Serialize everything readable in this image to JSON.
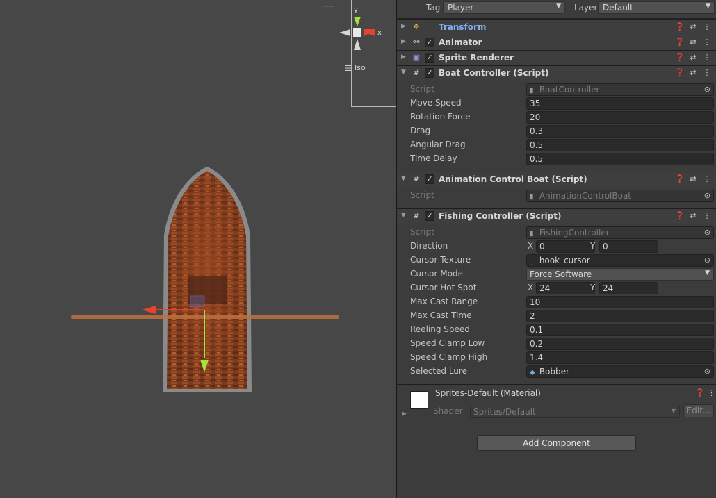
{
  "header": {
    "tag_label": "Tag",
    "tag_value": "Player",
    "layer_label": "Layer",
    "layer_value": "Default"
  },
  "scene": {
    "gizmo_y": "y",
    "gizmo_x": "x",
    "projection": "Iso"
  },
  "components": [
    {
      "title": "Transform",
      "icon": "transform-icon"
    },
    {
      "title": "Animator",
      "icon": "animator-icon"
    },
    {
      "title": "Sprite Renderer",
      "icon": "sprite-renderer-icon"
    },
    {
      "title": "Boat Controller (Script)",
      "icon": "script-icon"
    },
    {
      "title": "Animation Control Boat (Script)",
      "icon": "script-icon"
    },
    {
      "title": "Fishing Controller (Script)",
      "icon": "script-icon"
    }
  ],
  "boat_controller": {
    "script_label": "Script",
    "script_value": "BoatController",
    "fields": [
      {
        "label": "Move Speed",
        "value": "35"
      },
      {
        "label": "Rotation Force",
        "value": "20"
      },
      {
        "label": "Drag",
        "value": "0.3"
      },
      {
        "label": "Angular Drag",
        "value": "0.5"
      },
      {
        "label": "Time Delay",
        "value": "0.5"
      }
    ]
  },
  "animation_control": {
    "script_label": "Script",
    "script_value": "AnimationControlBoat"
  },
  "fishing_controller": {
    "script_label": "Script",
    "script_value": "FishingController",
    "direction_label": "Direction",
    "direction_x": "0",
    "direction_y": "0",
    "cursor_texture_label": "Cursor Texture",
    "cursor_texture_value": "hook_cursor",
    "cursor_mode_label": "Cursor Mode",
    "cursor_mode_value": "Force Software",
    "hot_spot_label": "Cursor Hot Spot",
    "hot_spot_x": "24",
    "hot_spot_y": "24",
    "fields": [
      {
        "label": "Max Cast Range",
        "value": "10"
      },
      {
        "label": "Max Cast Time",
        "value": "2"
      },
      {
        "label": "Reeling Speed",
        "value": "0.1"
      },
      {
        "label": "Speed Clamp Low",
        "value": "0.2"
      },
      {
        "label": "Speed Clamp High",
        "value": "1.4"
      }
    ],
    "lure_label": "Selected Lure",
    "lure_value": "Bobber",
    "x_label": "X",
    "y_label": "Y"
  },
  "material": {
    "title": "Sprites-Default (Material)",
    "shader_label": "Shader",
    "shader_value": "Sprites/Default",
    "edit_label": "Edit..."
  },
  "add_component_label": "Add Component",
  "colors": {
    "scene_bg": "#474747",
    "inspector_bg": "#3c3c3c",
    "x_axis": "#e8412c",
    "y_axis": "#a4e23c",
    "transform_title": "#7fb1f5"
  }
}
